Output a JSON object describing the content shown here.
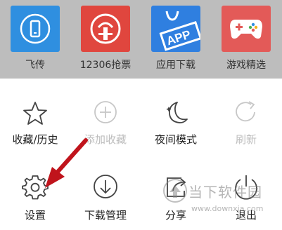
{
  "apps": [
    {
      "label": "飞传",
      "icon": "phone-transfer-icon",
      "color": "#2f8fe0"
    },
    {
      "label": "12306抢票",
      "icon": "train-logo-icon",
      "color": "#e0463e"
    },
    {
      "label": "应用下载",
      "icon": "app-bag-icon",
      "color": "#2f7fe0"
    },
    {
      "label": "游戏精选",
      "icon": "gamepad-icon",
      "color": "#e35a58"
    }
  ],
  "menu": {
    "items": [
      {
        "label": "收藏/历史",
        "icon": "star-icon",
        "enabled": true
      },
      {
        "label": "添加收藏",
        "icon": "plus-circle-icon",
        "enabled": false
      },
      {
        "label": "夜间模式",
        "icon": "moon-icon",
        "enabled": true
      },
      {
        "label": "刷新",
        "icon": "refresh-icon",
        "enabled": false
      },
      {
        "label": "设置",
        "icon": "gear-icon",
        "enabled": true
      },
      {
        "label": "下载管理",
        "icon": "download-icon",
        "enabled": true
      },
      {
        "label": "分享",
        "icon": "share-icon",
        "enabled": true
      },
      {
        "label": "退出",
        "icon": "power-icon",
        "enabled": true
      }
    ]
  },
  "watermark": {
    "text": "当下软件园",
    "url": "www.downxia.com"
  },
  "colors": {
    "annotation_arrow": "#c0141c",
    "strip_bg": "#bdbdbd"
  }
}
